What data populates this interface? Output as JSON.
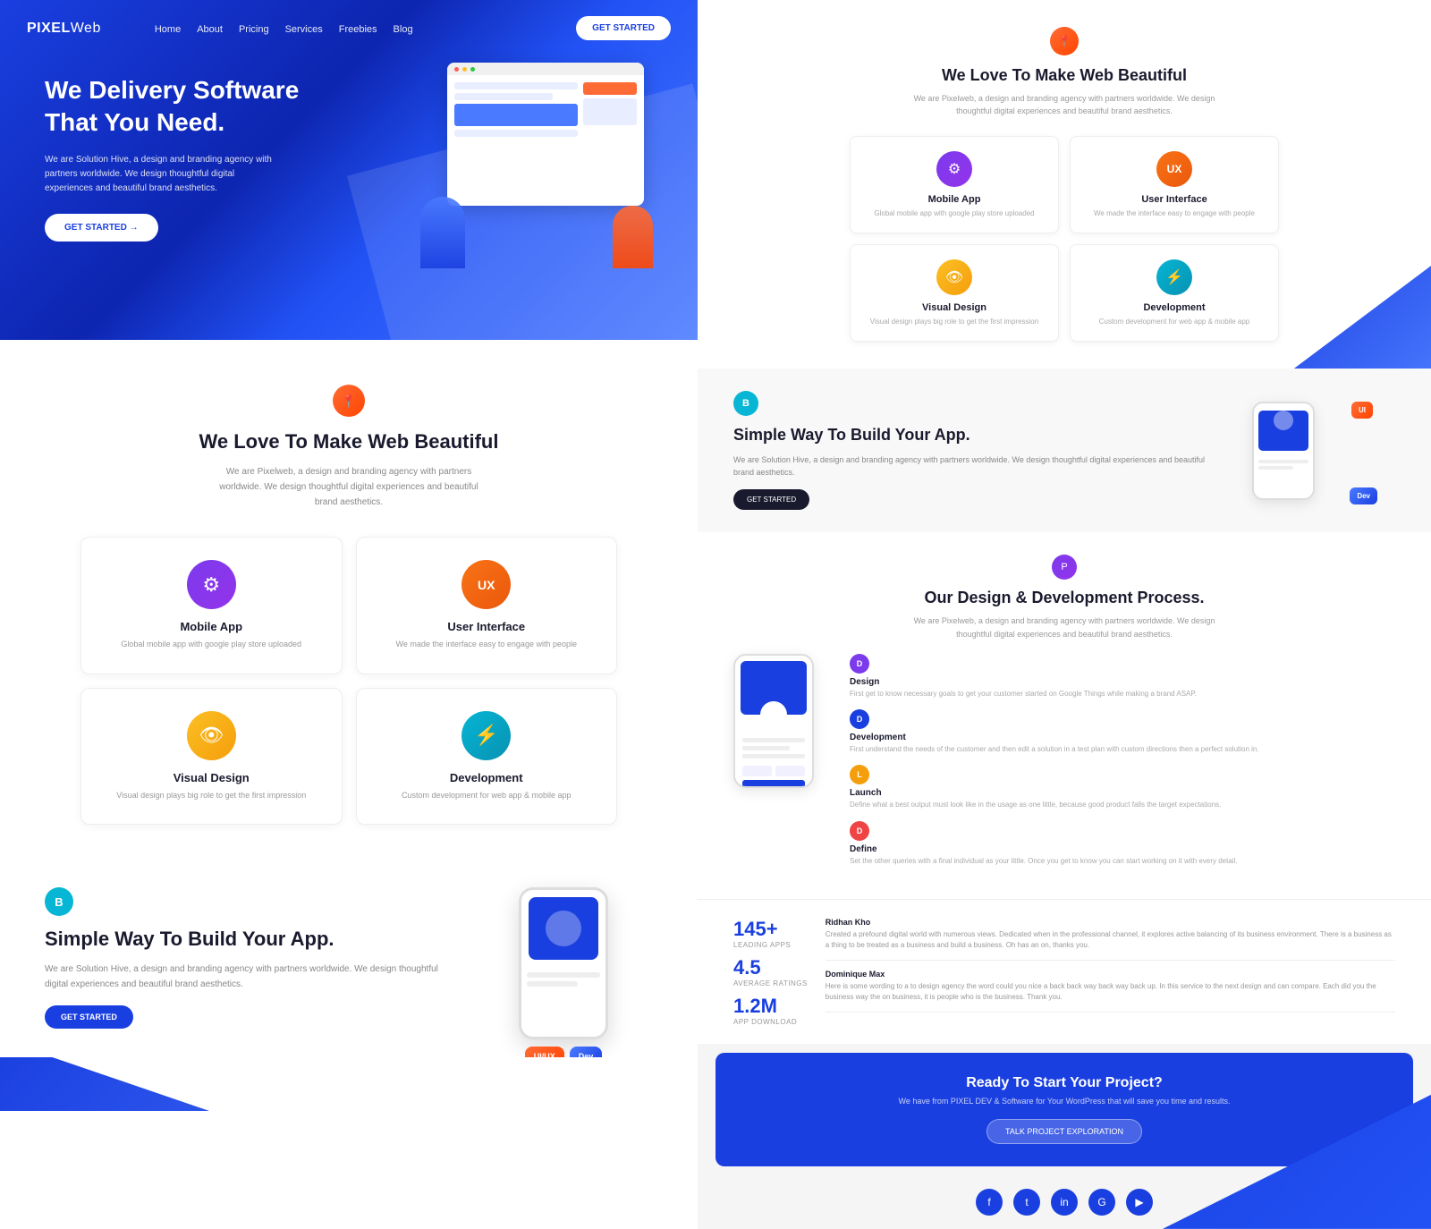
{
  "app": {
    "logo": "PIXEL",
    "logo_suffix": "Web"
  },
  "nav": {
    "links": [
      "Home",
      "About",
      "Pricing",
      "Services",
      "Freebies",
      "Blog"
    ],
    "cta_label": "GET STARTED"
  },
  "hero": {
    "title": "We Delivery Software That You Need.",
    "description": "We are Solution Hive, a design and branding agency with partners worldwide. We design thoughtful digital experiences and beautiful brand aesthetics.",
    "cta_label": "GET STARTED →"
  },
  "services_section": {
    "badge_icon": "📍",
    "title": "We Love To Make Web Beautiful",
    "description": "We are Pixelweb, a design and branding agency with partners worldwide. We design thoughtful digital experiences and beautiful brand aesthetics.",
    "services": [
      {
        "icon": "⚙",
        "color": "purple",
        "name": "Mobile App",
        "description": "Global mobile app with google play store uploaded"
      },
      {
        "icon": "UX",
        "color": "orange",
        "name": "User Interface",
        "description": "We made the interface easy to engage with people"
      },
      {
        "icon": "👁",
        "color": "yellow",
        "name": "Visual Design",
        "description": "Visual design plays big role to get the first impression"
      },
      {
        "icon": "⚡",
        "color": "cyan",
        "name": "Development",
        "description": "Custom development for web app & mobile app"
      }
    ]
  },
  "build_section": {
    "badge": "B",
    "title": "Simple Way To Build Your App.",
    "description": "We are Solution Hive, a design and branding agency with partners worldwide. We design thoughtful digital experiences and beautiful brand aesthetics.",
    "cta_label": "GET STARTED"
  },
  "right_services": {
    "badge_icon": "📍",
    "title": "We Love To Make Web Beautiful",
    "description": "We are Pixelweb, a design and branding agency with partners worldwide. We design thoughtful digital experiences and beautiful brand aesthetics.",
    "services": [
      {
        "icon": "⚙",
        "color": "purple",
        "name": "Mobile App",
        "description": "Global mobile app with google play store uploaded"
      },
      {
        "icon": "UX",
        "color": "orange",
        "name": "User Interface",
        "description": "We made the interface easy to engage with people"
      },
      {
        "icon": "👁",
        "color": "yellow",
        "name": "Visual Design",
        "description": "Visual design plays big role to get the first impression"
      },
      {
        "icon": "⚡",
        "color": "cyan",
        "name": "Development",
        "description": "Custom development for web app & mobile app"
      }
    ]
  },
  "right_build": {
    "badge": "B",
    "title": "Simple Way To Build Your App.",
    "description": "We are Solution Hive, a design and branding agency with partners worldwide. We design thoughtful digital experiences and beautiful brand aesthetics.",
    "cta_label": "GET STARTED"
  },
  "process": {
    "badge": "P",
    "title": "Our Design & Development Process.",
    "description": "We are Pixelweb, a design and branding agency with partners worldwide. We design thoughtful digital experiences and beautiful brand aesthetics.",
    "steps": [
      {
        "badge": "D",
        "color": "purple",
        "name": "Design",
        "desc": "First get to know necessary goals to get your customer started on Google Things while making a brand ASAP."
      },
      {
        "badge": "D",
        "color": "blue",
        "name": "Development",
        "desc": "First understand the needs of the customer and then edit a solution in a test plan with custom directions then a perfect solution in."
      },
      {
        "badge": "L",
        "color": "yellow",
        "name": "Launch",
        "desc": "Define what a best output must look like in the usage as one little, because good product falls the target expectations."
      },
      {
        "badge": "D",
        "color": "red",
        "name": "Define",
        "desc": "Set the other queries with a final individual as your little. Once you get to know you can start working on it with every detail."
      }
    ]
  },
  "stats": {
    "items": [
      {
        "number": "145+",
        "label": "LEADING APPS"
      },
      {
        "number": "4.5",
        "label": "AVERAGE RATINGS"
      },
      {
        "number": "1.2M",
        "label": "APP DOWNLOAD"
      }
    ],
    "testimonials": [
      {
        "author": "Ridhan Kho",
        "text": "Created a prefound digital world with numerous views. Dedicated when in the professional channel, it explores active balancing of its business environment. There is a business as a thing to be treated as a business and build a business. Oh has an on, thanks you."
      },
      {
        "author": "Dominique Max",
        "text": "Here is some wording to a to design agency the word could you nice a back back way back way back up. In this service to the next design and can compare. Each did you the business way the on business, it is people who is the business. Thank you."
      }
    ]
  },
  "cta": {
    "title": "Ready To Start Your Project?",
    "description": "We have from PIXEL DEV & Software for Your WordPress that will save you time and results.",
    "btn_label": "TALK PROJECT EXPLORATION"
  },
  "social_icons": [
    "f",
    "t",
    "in",
    "G+",
    "yt"
  ]
}
